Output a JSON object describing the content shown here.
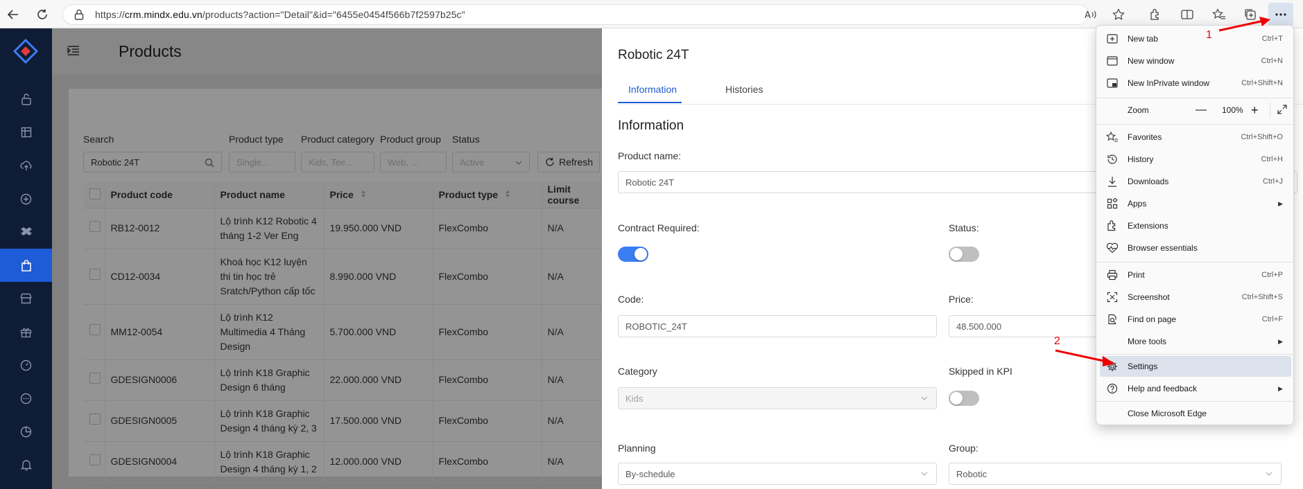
{
  "browser": {
    "url": "https://crm.mindx.edu.vn/products?action=\"Detail\"&id=\"6455e0454f566b7f2597b25c\"",
    "url_host": "crm.mindx.edu.vn",
    "url_prefix": "https://",
    "url_path": "/products?action=\"Detail\"&id=\"6455e0454f566b7f2597b25c\"",
    "toolbar_icons": [
      "read-aloud-icon",
      "favorite-star-icon",
      "extensions-icon",
      "split-screen-icon",
      "favorites-icon",
      "collections-icon",
      "more-icon"
    ]
  },
  "sidebar": {
    "accent": "#1e5bd6",
    "bg": "#0f1c36",
    "items": [
      "lock-icon",
      "board-icon",
      "cloud-upload-icon",
      "plus-circle-icon",
      "dropbox-icon",
      "shopping-bag-icon",
      "store-icon",
      "gift-icon",
      "dashboard-icon",
      "chat-icon",
      "pie-chart-icon",
      "bell-icon"
    ],
    "active_index": 5
  },
  "page": {
    "title": "Products"
  },
  "filters": {
    "search_label": "Search",
    "search_value": "Robotic 24T",
    "type_label": "Product type",
    "type_placeholder": "Single...",
    "category_label": "Product category",
    "category_placeholder": "Kids, Tee...",
    "group_label": "Product group",
    "group_placeholder": "Web, ...",
    "status_label": "Status",
    "status_value": "Active",
    "refresh_label": "Refresh"
  },
  "table": {
    "columns": [
      "Product code",
      "Product name",
      "Price",
      "Product type",
      "Limit course"
    ],
    "rows": [
      {
        "code": "RB12-0012",
        "name": [
          "Lộ trình K12 Robotic 4",
          "tháng 1-2 Ver Eng"
        ],
        "price": "19.950.000 VND",
        "type": "FlexCombo",
        "limit": "N/A"
      },
      {
        "code": "CD12-0034",
        "name": [
          "Khoá học K12 luyện",
          "thi tin học trẻ",
          "Sratch/Python cấp tốc"
        ],
        "price": "8.990.000 VND",
        "type": "FlexCombo",
        "limit": "N/A"
      },
      {
        "code": "MM12-0054",
        "name": [
          "Lộ trình K12",
          "Multimedia 4 Tháng",
          "Design"
        ],
        "price": "5.700.000 VND",
        "type": "FlexCombo",
        "limit": "N/A"
      },
      {
        "code": "GDESIGN0006",
        "name": [
          "Lộ trình K18 Graphic",
          "Design 6 tháng"
        ],
        "price": "22.000.000 VND",
        "type": "FlexCombo",
        "limit": "N/A"
      },
      {
        "code": "GDESIGN0005",
        "name": [
          "Lộ trình K18 Graphic",
          "Design 4 tháng kỳ 2, 3"
        ],
        "price": "17.500.000 VND",
        "type": "FlexCombo",
        "limit": "N/A"
      },
      {
        "code": "GDESIGN0004",
        "name": [
          "Lộ trình K18 Graphic",
          "Design 4 tháng kỳ 1, 2"
        ],
        "price": "12.000.000 VND",
        "type": "FlexCombo",
        "limit": "N/A"
      }
    ]
  },
  "drawer": {
    "title": "Robotic 24T",
    "tabs": [
      "Information",
      "Histories"
    ],
    "section_title": "Information",
    "product_name_label": "Product name:",
    "product_name_value": "Robotic 24T",
    "contract_required_label": "Contract Required:",
    "contract_required_on": true,
    "status_label": "Status:",
    "status_on": false,
    "code_label": "Code:",
    "code_value": "ROBOTIC_24T",
    "price_label": "Price:",
    "price_value": "48.500.000",
    "category_label": "Category",
    "category_value": "Kids",
    "skipped_kpi_label": "Skipped in KPI",
    "skipped_kpi_on": false,
    "planning_label": "Planning",
    "planning_value": "By-schedule",
    "group_label": "Group:",
    "group_value": "Robotic"
  },
  "edge_menu": {
    "new_tab": {
      "label": "New tab",
      "shortcut": "Ctrl+T"
    },
    "new_window": {
      "label": "New window",
      "shortcut": "Ctrl+N"
    },
    "new_inprivate": {
      "label": "New InPrivate window",
      "shortcut": "Ctrl+Shift+N"
    },
    "zoom": {
      "label": "Zoom",
      "value": "100%"
    },
    "favorites": {
      "label": "Favorites",
      "shortcut": "Ctrl+Shift+O"
    },
    "history": {
      "label": "History",
      "shortcut": "Ctrl+H"
    },
    "downloads": {
      "label": "Downloads",
      "shortcut": "Ctrl+J"
    },
    "apps": {
      "label": "Apps"
    },
    "extensions": {
      "label": "Extensions"
    },
    "browser_essentials": {
      "label": "Browser essentials"
    },
    "print": {
      "label": "Print",
      "shortcut": "Ctrl+P"
    },
    "screenshot": {
      "label": "Screenshot",
      "shortcut": "Ctrl+Shift+S"
    },
    "find_on_page": {
      "label": "Find on page",
      "shortcut": "Ctrl+F"
    },
    "more_tools": {
      "label": "More tools"
    },
    "settings": {
      "label": "Settings"
    },
    "help_feedback": {
      "label": "Help and feedback"
    },
    "close_edge": {
      "label": "Close Microsoft Edge"
    }
  },
  "annotations": {
    "step1": "1",
    "step2": "2",
    "color": "#e00000"
  }
}
